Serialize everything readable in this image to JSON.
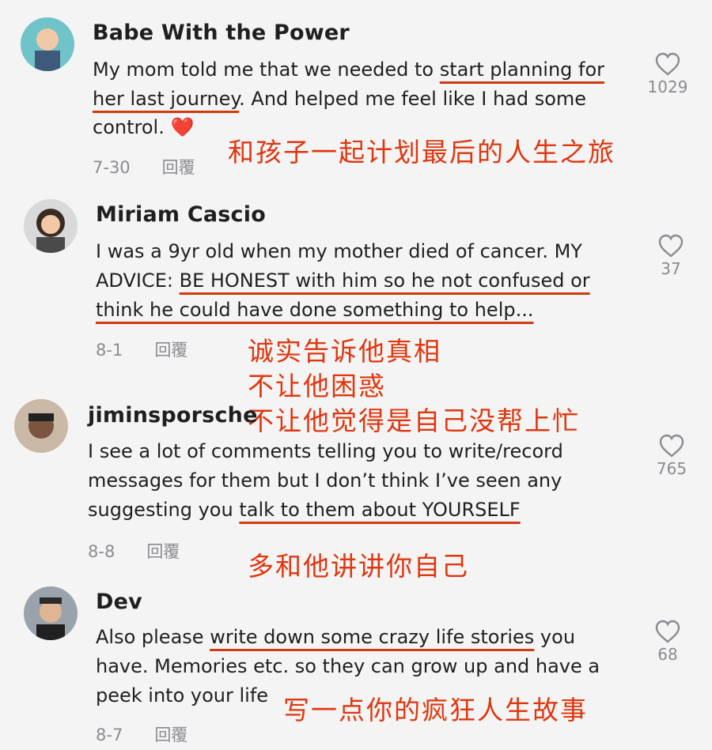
{
  "comments": [
    {
      "username": "Babe With the Power",
      "lines": [
        {
          "pre": "My mom told me that we needed to ",
          "u": "start planning for",
          "post": ""
        },
        {
          "pre": "",
          "u": "her last journey",
          "post": ". And helped me feel like I had some"
        },
        {
          "pre": "control. ",
          "u": "",
          "post": ""
        }
      ],
      "emoji": "❤️",
      "date": "7-30",
      "reply_label": "回覆",
      "likes": "1029",
      "notes": [
        "和孩子一起计划最后的人生之旅"
      ]
    },
    {
      "username": "Miriam Cascio",
      "lines": [
        {
          "pre": "I was a 9yr old when my mother died of cancer. MY",
          "u": "",
          "post": ""
        },
        {
          "pre": "ADVICE: ",
          "u": "BE HONEST with him so he not confused or",
          "post": ""
        },
        {
          "pre": "",
          "u": "think he could have done something to help...",
          "post": ""
        }
      ],
      "date": "8-1",
      "reply_label": "回覆",
      "likes": "37",
      "notes": [
        "诚实告诉他真相",
        "不让他困惑",
        "不让他觉得是自己没帮上忙"
      ]
    },
    {
      "username": "jiminsporsche",
      "lines": [
        {
          "pre": "I see a lot of comments telling you to write/record",
          "u": "",
          "post": ""
        },
        {
          "pre": "messages for them but I don’t think I’ve seen any",
          "u": "",
          "post": ""
        },
        {
          "pre": "suggesting you ",
          "u": "talk to them about YOURSELF",
          "post": ""
        }
      ],
      "date": "8-8",
      "reply_label": "回覆",
      "likes": "765",
      "notes": [
        "多和他讲讲你自己"
      ]
    },
    {
      "username": "Dev",
      "lines": [
        {
          "pre": "Also please ",
          "u": "write down some crazy life stories",
          "post": " you"
        },
        {
          "pre": "have. Memories etc. so they can grow up and have a",
          "u": "",
          "post": ""
        },
        {
          "pre": "peek into your life",
          "u": "",
          "post": ""
        }
      ],
      "date": "8-7",
      "reply_label": "回覆",
      "likes": "68",
      "notes": [
        "写一点你的疯狂人生故事"
      ]
    }
  ],
  "colors": {
    "accent_red": "#e0360e",
    "underline": "#d23a12",
    "muted": "#8a8b91"
  },
  "icons": {
    "like": "heart-outline-icon",
    "emoji": "red-heart-emoji"
  }
}
